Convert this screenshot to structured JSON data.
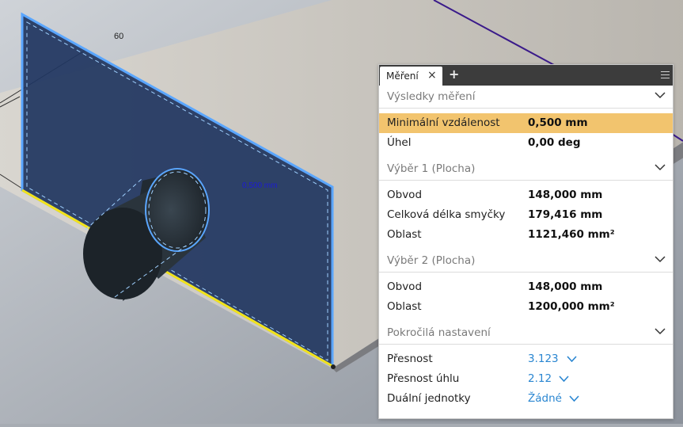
{
  "viewport": {
    "dimension_label": "60",
    "measure_label": "0,500 mm"
  },
  "panel": {
    "tab_title": "Měření",
    "tab_close": "×",
    "tab_add": "+",
    "sections": {
      "results": {
        "title": "Výsledky měření",
        "rows": [
          {
            "label": "Minimální vzdálenost",
            "value": "0,500 mm"
          },
          {
            "label": "Úhel",
            "value": "0,00 deg"
          }
        ]
      },
      "selection1": {
        "title": "Výběr 1 (Plocha)",
        "rows": [
          {
            "label": "Obvod",
            "value": "148,000 mm"
          },
          {
            "label": "Celková délka smyčky",
            "value": "179,416 mm"
          },
          {
            "label": "Oblast",
            "value": "1121,460 mm²"
          }
        ]
      },
      "selection2": {
        "title": "Výběr 2 (Plocha)",
        "rows": [
          {
            "label": "Obvod",
            "value": "148,000 mm"
          },
          {
            "label": "Oblast",
            "value": "1200,000 mm²"
          }
        ]
      },
      "advanced": {
        "title": "Pokročilá nastavení",
        "rows": [
          {
            "label": "Přesnost",
            "value": "3.123"
          },
          {
            "label": "Přesnost úhlu",
            "value": "2.12"
          },
          {
            "label": "Duální jednotky",
            "value": "Žádné"
          }
        ]
      }
    }
  },
  "colors": {
    "highlight": "#f2c46e",
    "link_blue": "#2a86d1",
    "face_blue": "#1f3560",
    "edge_yellow": "#f2e21a"
  }
}
